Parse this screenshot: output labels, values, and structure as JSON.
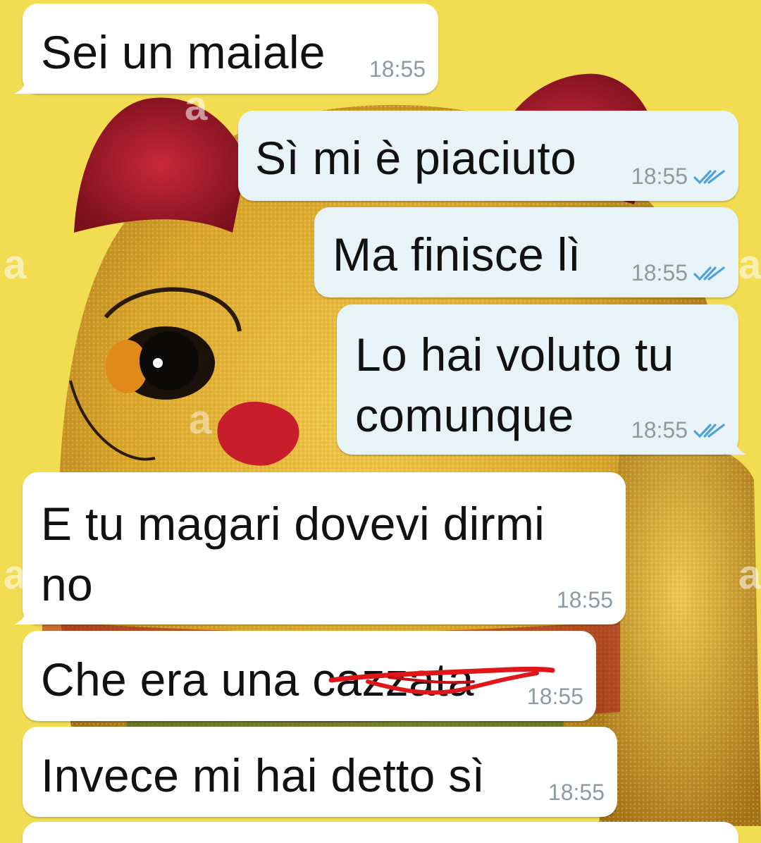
{
  "messages": [
    {
      "direction": "in",
      "text": "Sei un maiale",
      "time": "18:55"
    },
    {
      "direction": "out",
      "text": "Sì mi è piaciuto",
      "time": "18:55",
      "status_icon": "double-check-read-icon"
    },
    {
      "direction": "out",
      "text": "Ma finisce lì",
      "time": "18:55",
      "status_icon": "double-check-read-icon"
    },
    {
      "direction": "out",
      "text": "Lo hai voluto tu\ncomunque",
      "time": "18:55",
      "status_icon": "double-check-read-icon"
    },
    {
      "direction": "in",
      "text": "E tu magari dovevi dirmi\nno",
      "time": "18:55"
    },
    {
      "direction": "in",
      "text": "Che era una cazzata",
      "time": "18:55",
      "annotation": "red-scribble-over-word"
    },
    {
      "direction": "in",
      "text": "Invece mi hai detto sì",
      "time": "18:55"
    }
  ],
  "watermark": "a",
  "colors": {
    "wallpaper": "#f1dc52",
    "incoming_bubble": "#ffffff",
    "outgoing_bubble": "#e8f3f8",
    "timestamp": "#8e9aa2",
    "read_ticks": "#4fa3d8",
    "scribble": "#e0161b"
  }
}
